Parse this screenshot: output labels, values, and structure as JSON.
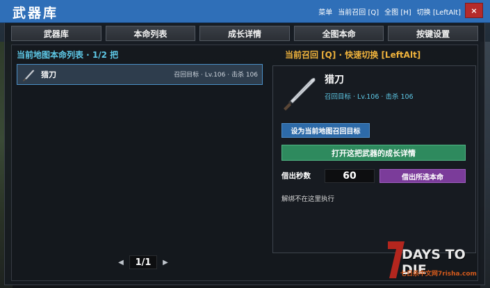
{
  "window": {
    "title": "武器库",
    "menu_label": "菜单",
    "recall_label": "当前召回 [Q]",
    "map_label": "全图 [H]",
    "switch_label": "切换 [LeftAlt]",
    "close_label": "×"
  },
  "tabs": [
    {
      "label": "武器库"
    },
    {
      "label": "本命列表"
    },
    {
      "label": "成长详情"
    },
    {
      "label": "全图本命"
    },
    {
      "label": "按键设置"
    }
  ],
  "list": {
    "header": "当前地图本命列表 · 1/2 把",
    "items": [
      {
        "name": "猎刀",
        "meta": "召回目标 · Lv.106 · 击杀 106"
      }
    ]
  },
  "detail": {
    "hint": "当前召回 [Q] · 快速切换 [LeftAlt]",
    "name": "猎刀",
    "meta": "召回目标 · Lv.106 · 击杀 106",
    "set_target_label": "设为当前地图召回目标",
    "open_growth_label": "打开这把武器的成长详情",
    "borrow_seconds_label": "借出秒数",
    "borrow_seconds_value": "60",
    "borrow_button_label": "借出所选本命",
    "unbind_note": "解绑不在这里执行"
  },
  "pager": {
    "prev": "◀",
    "page": "1/1",
    "next": "▶"
  },
  "logo": {
    "number": "7",
    "text": "DAYS TO DIE",
    "sub": "七日杀中文网7risha.com"
  },
  "colors": {
    "titlebar": "#2f6fb8",
    "accent_cyan": "#5ec8e6",
    "accent_orange": "#f0b33c",
    "button_blue": "#2d6aa8",
    "button_green": "#2e8a5e",
    "button_purple": "#7b3c9a",
    "close_red": "#b52b2b"
  }
}
